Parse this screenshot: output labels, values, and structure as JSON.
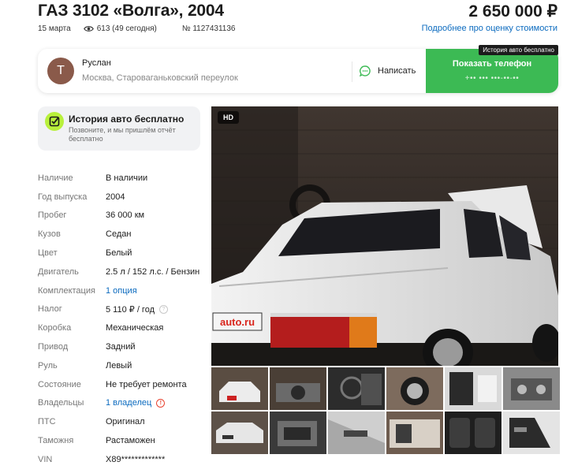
{
  "listing": {
    "title": "ГАЗ 3102 «Волга», 2004",
    "price": "2 650 000 ₽",
    "date": "15 марта",
    "views": "613 (49 сегодня)",
    "number": "№ 1127431136",
    "price_link": "Подробнее про оценку стоимости"
  },
  "seller": {
    "initial": "Т",
    "name": "Руслан",
    "address": "Москва, Староваганьковский переулок",
    "message_label": "Написать",
    "phone_label": "Показать телефон",
    "phone_mask": "+•• ••• •••-••-••",
    "tooltip": "История авто бесплатно"
  },
  "history": {
    "title": "История авто бесплатно",
    "subtitle": "Позвоните, и мы пришлём отчёт бесплатно"
  },
  "specs": [
    {
      "label": "Наличие",
      "value": "В наличии"
    },
    {
      "label": "Год выпуска",
      "value": "2004"
    },
    {
      "label": "Пробег",
      "value": "36 000 км"
    },
    {
      "label": "Кузов",
      "value": "Седан"
    },
    {
      "label": "Цвет",
      "value": "Белый"
    },
    {
      "label": "Двигатель",
      "value": "2.5 л / 152 л.с. / Бензин"
    },
    {
      "label": "Комплектация",
      "value": "1 опция"
    },
    {
      "label": "Налог",
      "value": "5 110 ₽ / год"
    },
    {
      "label": "Коробка",
      "value": "Механическая"
    },
    {
      "label": "Привод",
      "value": "Задний"
    },
    {
      "label": "Руль",
      "value": "Левый"
    },
    {
      "label": "Состояние",
      "value": "Не требует ремонта"
    },
    {
      "label": "Владельцы",
      "value": "1 владелец"
    },
    {
      "label": "ПТС",
      "value": "Оригинал"
    },
    {
      "label": "Таможня",
      "value": "Растаможен"
    },
    {
      "label": "VIN",
      "value": "X89*************"
    }
  ],
  "gallery": {
    "badge": "HD",
    "plate_text": "auto.ru"
  },
  "colors": {
    "accent_green": "#3cba54",
    "link_blue": "#0c6bbf",
    "history_icon": "#b8f03c"
  }
}
